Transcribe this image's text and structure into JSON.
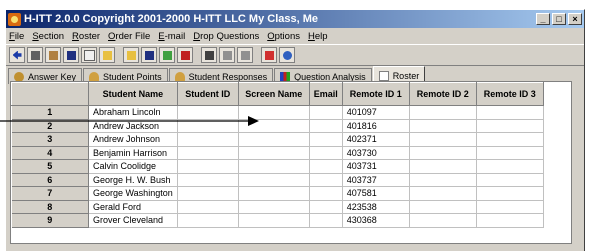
{
  "window": {
    "title": "H-ITT 2.0.0 Copyright 2001-2000 H-ITT LLC My Class, Me",
    "controls": [
      "_",
      "□",
      "×"
    ]
  },
  "menu": [
    "File",
    "Section",
    "Roster",
    "Order File",
    "E-mail",
    "Drop Questions",
    "Options",
    "Help"
  ],
  "tabs": [
    {
      "label": "Answer Key",
      "icon": "key-icon"
    },
    {
      "label": "Student Points",
      "icon": "students-icon"
    },
    {
      "label": "Student Responses",
      "icon": "students-icon"
    },
    {
      "label": "Question Analysis",
      "icon": "bar-chart-icon"
    },
    {
      "label": "Roster",
      "icon": "roster-icon"
    }
  ],
  "table": {
    "columns": [
      "",
      "Student Name",
      "Student ID",
      "Screen Name",
      "Email",
      "Remote ID 1",
      "Remote ID 2",
      "Remote ID 3"
    ],
    "rows": [
      [
        "1",
        "Abraham Lincoln",
        "",
        "",
        "",
        "401097",
        "",
        ""
      ],
      [
        "2",
        "Andrew Jackson",
        "",
        "",
        "",
        "401816",
        "",
        ""
      ],
      [
        "3",
        "Andrew Johnson",
        "",
        "",
        "",
        "402371",
        "",
        ""
      ],
      [
        "4",
        "Benjamin Harrison",
        "",
        "",
        "",
        "403730",
        "",
        ""
      ],
      [
        "5",
        "Calvin Coolidge",
        "",
        "",
        "",
        "403731",
        "",
        ""
      ],
      [
        "6",
        "George H. W. Bush",
        "",
        "",
        "",
        "403737",
        "",
        ""
      ],
      [
        "7",
        "George Washington",
        "",
        "",
        "",
        "407581",
        "",
        ""
      ],
      [
        "8",
        "Gerald Ford",
        "",
        "",
        "",
        "423538",
        "",
        ""
      ],
      [
        "9",
        "Grover Cleveland",
        "",
        "",
        "",
        "430368",
        "",
        ""
      ]
    ]
  }
}
